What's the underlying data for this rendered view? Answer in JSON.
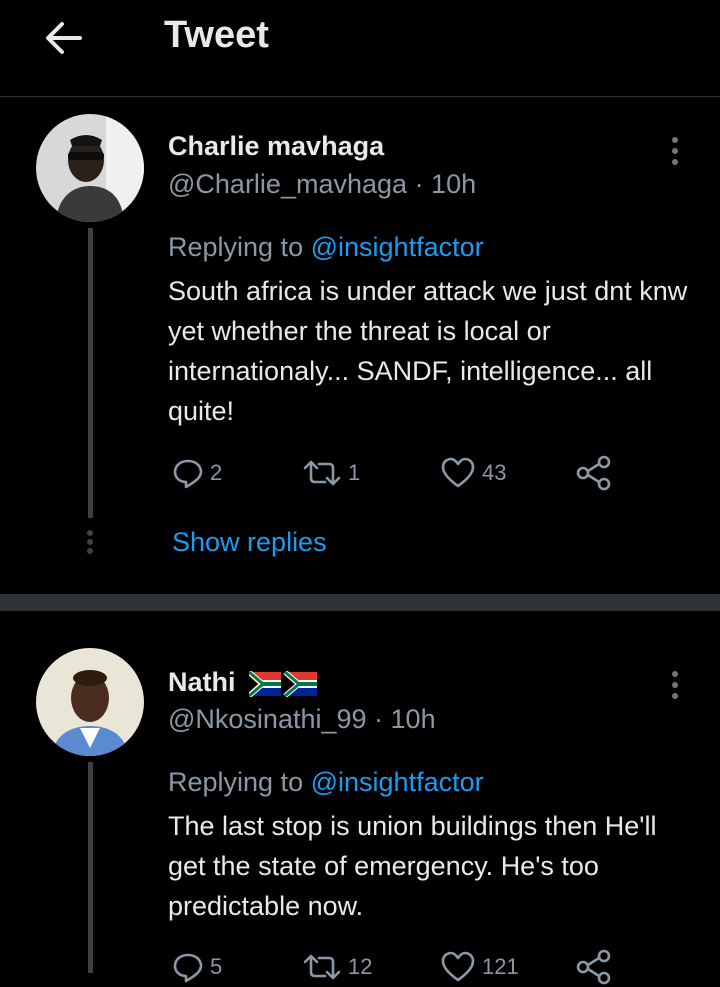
{
  "header": {
    "title": "Tweet",
    "back_icon": "arrow-left-icon"
  },
  "tweets": [
    {
      "name": "Charlie mavhaga",
      "handle": "@Charlie_mavhaga",
      "time": "· 10h",
      "reply_prefix": "Replying to",
      "reply_mention": "@insightfactor",
      "text": "South africa is under attack we just dnt knw yet whether the threat is local or internationaly... SANDF, intelligence... all quite!",
      "replies": "2",
      "retweets": "1",
      "likes": "43",
      "show_replies": "Show replies"
    },
    {
      "name": "Nathi",
      "handle": "@Nkosinathi_99",
      "time": "· 10h",
      "reply_prefix": "Replying to",
      "reply_mention": "@insightfactor",
      "text": "The last stop is union buildings then He'll get the state of emergency. He's too predictable now.",
      "replies": "5",
      "retweets": "12",
      "likes": "121"
    }
  ],
  "colors": {
    "background": "#000000",
    "accent": "#1d9bf0",
    "muted": "#8b98a5",
    "text": "#e7e9ea"
  }
}
